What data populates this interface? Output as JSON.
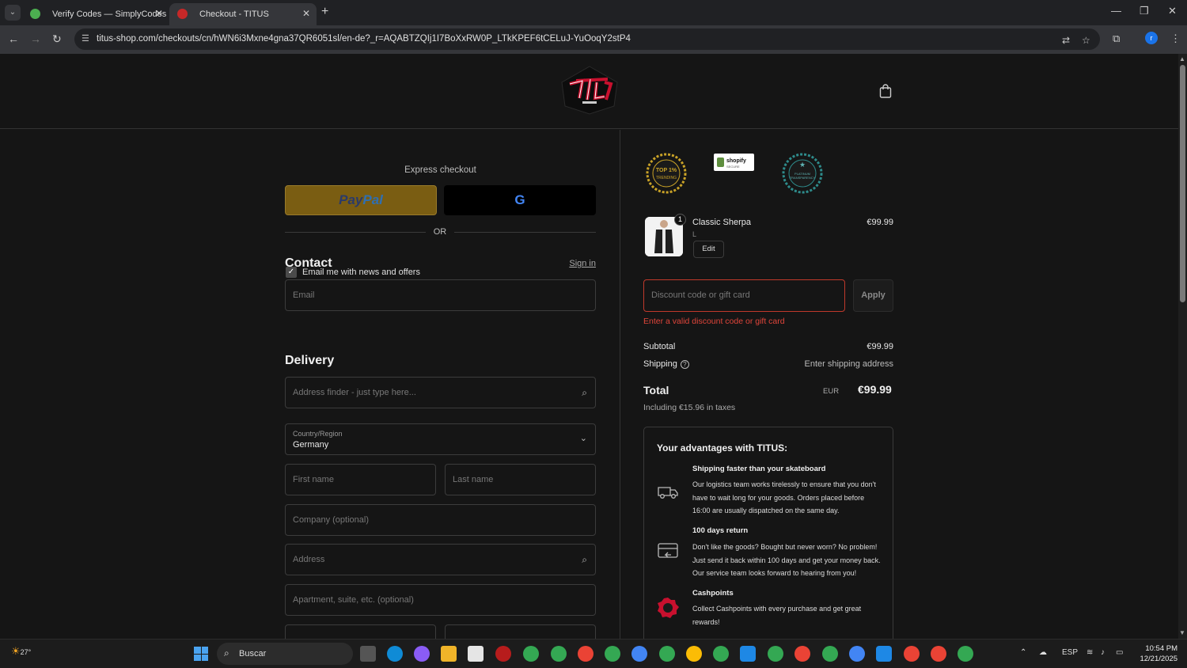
{
  "browser": {
    "tabs": [
      {
        "title": "Verify Codes — SimplyCodes",
        "active": false,
        "favicon_color": "#4caf50"
      },
      {
        "title": "Checkout - TITUS",
        "active": true,
        "favicon_color": "#c62828"
      }
    ],
    "url": "titus-shop.com/checkouts/cn/hWN6i3Mxne4gna37QR6051sl/en-de?_r=AQABTZQIj1I7BoXxRW0P_LTkKPEF6tCELuJ-YuOoqY2stP4",
    "profile_initial": "r"
  },
  "checkout": {
    "express_label": "Express checkout",
    "paypal_label_a": "Pay",
    "paypal_label_b": "Pal",
    "gpay_label": "G",
    "or_label": "OR",
    "contact_heading": "Contact",
    "sign_in": "Sign in",
    "email_placeholder": "Email",
    "news_label": "Email me with news and offers",
    "news_checked": true,
    "delivery_heading": "Delivery",
    "address_finder_placeholder": "Address finder - just type here...",
    "country_label": "Country/Region",
    "country_value": "Germany",
    "first_name_placeholder": "First name",
    "last_name_placeholder": "Last name",
    "company_placeholder": "Company (optional)",
    "address_placeholder": "Address",
    "apartment_placeholder": "Apartment, suite, etc. (optional)"
  },
  "summary": {
    "badges": [
      "TOP 1% TRENDING",
      "shopify SECURE",
      "PLATINUM TRANSPARENCY"
    ],
    "product": {
      "name": "Classic Sherpa",
      "variant": "L",
      "qty": "1",
      "price": "€99.99",
      "edit": "Edit"
    },
    "discount_placeholder": "Discount code or gift card",
    "apply": "Apply",
    "error": "Enter a valid discount code or gift card",
    "subtotal_label": "Subtotal",
    "subtotal_value": "€99.99",
    "shipping_label": "Shipping",
    "shipping_value": "Enter shipping address",
    "total_label": "Total",
    "total_currency": "EUR",
    "total_value": "€99.99",
    "taxes": "Including €15.96 in taxes",
    "advantages_title": "Your advantages with TITUS:",
    "advantages": [
      {
        "title": "Shipping faster than your skateboard",
        "lines": [
          "Our logistics team works tirelessly to ensure that you don't",
          "have to wait long for your goods. Orders placed before",
          "16:00 are usually dispatched on the same day."
        ]
      },
      {
        "title": "100 days return",
        "lines": [
          "Don't like the goods? Bought but never worn? No problem!",
          "Just send it back within 100 days and get your money back.",
          "Our service team looks forward to hearing from you!"
        ]
      },
      {
        "title": "Cashpoints",
        "lines": [
          "Collect Cashpoints with every purchase and get great",
          "rewards!"
        ]
      }
    ]
  },
  "taskbar": {
    "weather": "27°",
    "search_label": "Buscar",
    "lang": "ESP",
    "time": "10:54 PM",
    "date": "12/21/2025"
  }
}
